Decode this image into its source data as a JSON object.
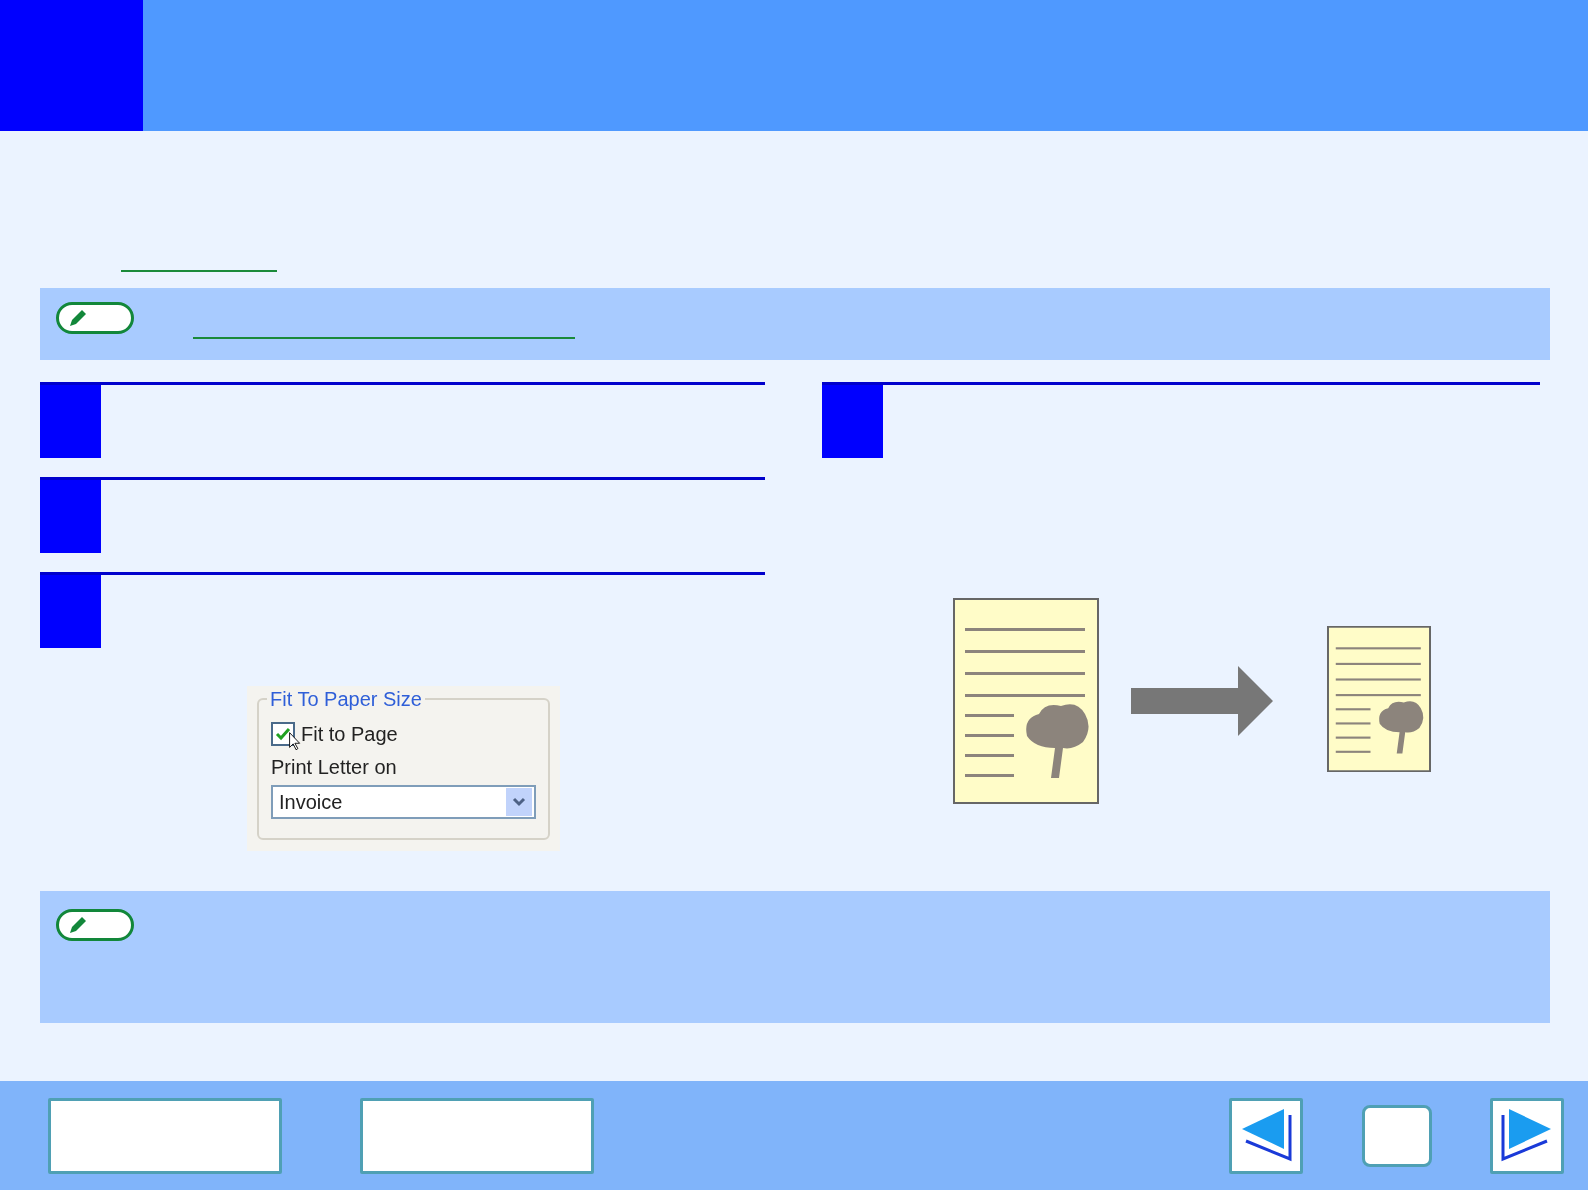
{
  "dialog": {
    "group_title": "Fit To Paper Size",
    "checkbox": {
      "label": "Fit to Page",
      "checked": true
    },
    "select_label": "Print Letter on",
    "select": {
      "value": "Invoice"
    }
  }
}
